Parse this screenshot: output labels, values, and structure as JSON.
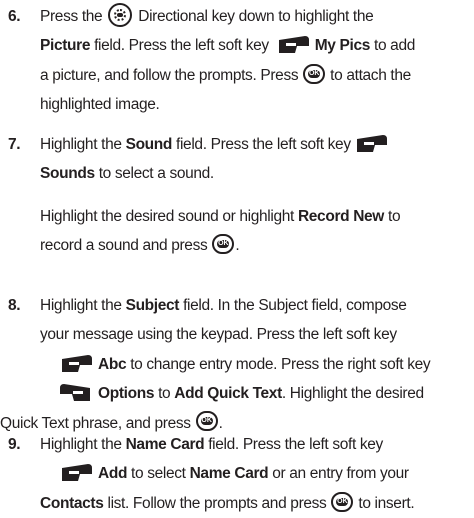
{
  "steps": [
    {
      "number": "6.",
      "lines": [
        [
          "Press the ",
          "{nav}",
          " Directional key down to highlight the"
        ],
        [
          "Picture",
          " field. Press the left soft key ",
          "My Pics",
          " to add"
        ],
        [
          "a picture, and follow the prompts. Press ",
          "{ok}",
          " to attach the"
        ],
        [
          "highlighted image."
        ]
      ]
    },
    {
      "number": "7.",
      "t1": "Highlight the ",
      "b1": "Sound",
      "t2": " field. Press the left soft key",
      "b2": "Sounds",
      "t3": " to select a sound.",
      "t4": "Highlight the desired sound or highlight ",
      "b3": "Record New",
      "t5": " to",
      "t6": "record a sound and press ",
      "t7": "."
    },
    {
      "number": "8.",
      "t1": "Highlight the ",
      "b1": "Subject",
      "t2": " field. In the Subject field, compose",
      "t3": "your message using the keypad. Press the left soft key",
      "b2": "Abc",
      "t4": " to change entry mode. Press the right soft key",
      "b3": "Options",
      "t5": " to ",
      "b4": "Add Quick Text",
      "t6": ". Highlight the desired",
      "t7": "Quick Text phrase, and press ",
      "t8": "."
    },
    {
      "number": "9.",
      "t1": "Highlight the ",
      "b1": "Name Card",
      "t2": " field. Press the left soft key",
      "b2": "Add",
      "t3": " to select ",
      "b3": "Name Card",
      "t4": " or an entry from your",
      "b4": "Contacts",
      "t5": " list. Follow the prompts and press ",
      "t6": " to insert."
    }
  ],
  "icons": {
    "ok_label": "OK",
    "nav": "directional-key-icon",
    "ok": "ok-key-icon",
    "left_softkey": "left-soft-key-icon",
    "right_softkey": "right-soft-key-icon"
  }
}
